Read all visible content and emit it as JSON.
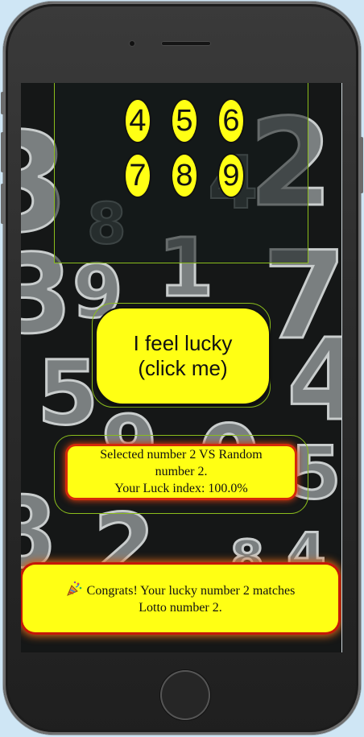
{
  "keypad": {
    "buttons": [
      "4",
      "5",
      "6",
      "7",
      "8",
      "9"
    ]
  },
  "lucky_button": {
    "line1": "I feel lucky",
    "line2": "(click me)"
  },
  "result": {
    "line1": "Selected number 2 VS Random",
    "line2": "number 2.",
    "line3": "Your Luck index: 100.0%"
  },
  "congrats": {
    "line1": "Congrats! Your lucky number 2 matches",
    "line2": "Lotto number 2.",
    "icon": "party-popper-icon"
  },
  "background": {
    "numbers": [
      "3",
      "8",
      "4",
      "2",
      "3",
      "9",
      "1",
      "7",
      "5",
      "4",
      "9",
      "0",
      "5",
      "8",
      "2",
      "8",
      "4"
    ]
  },
  "colors": {
    "button_yellow": "#ffff14",
    "frame_green": "#8bbd1c",
    "glow_red": "#d42a0a"
  }
}
